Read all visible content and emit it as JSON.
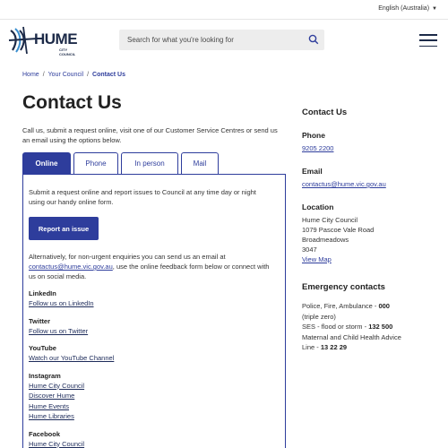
{
  "header": {
    "language": "English (Australia)",
    "logo_text": "HUME",
    "logo_sub": "CITY COUNCIL",
    "search_placeholder": "Search for what you're looking for"
  },
  "breadcrumb": [
    "Home",
    "Your Council",
    "Contact Us"
  ],
  "page_title": "Contact Us",
  "intro": "Call us, submit a request online, visit one of our Customer Service Centres or send us an email using the options below.",
  "tabs": [
    {
      "label": "Online",
      "active": true
    },
    {
      "label": "Phone",
      "active": false
    },
    {
      "label": "In person",
      "active": false
    },
    {
      "label": "Mail",
      "active": false
    }
  ],
  "online": {
    "text": "Submit a request online and report issues to Council at any time day or night using our handy online form.",
    "button": "Report an issue",
    "alt_before": "Alternatively, for non-urgent enquiries you can send us an email at ",
    "alt_email": "contactus@hume.vic.gov.au",
    "alt_after": ", use the online feedback form below or connect with us on social media.",
    "social": [
      {
        "title": "LinkedIn",
        "links": [
          "Follow us on LinkedIn"
        ]
      },
      {
        "title": "Twitter",
        "links": [
          "Follow us on Twitter"
        ]
      },
      {
        "title": "YouTube",
        "links": [
          "Watch our YouTube Channel"
        ]
      },
      {
        "title": "Instagram",
        "links": [
          "Hume City Council",
          "Discover Hume",
          "Hume Events",
          "Hume Libraries"
        ]
      },
      {
        "title": "Facebook",
        "links": [
          "Hume City Council"
        ]
      }
    ]
  },
  "sidebar": {
    "title": "Contact Us",
    "phone_label": "Phone",
    "phone": "9205 2200",
    "email_label": "Email",
    "email": "contactus@hume.vic.gov.au",
    "location_label": "Location",
    "address": [
      "Hume City Council",
      "1079 Pascoe Vale Road",
      "Broadmeadows",
      "3047"
    ],
    "map_link": "View Map"
  },
  "emergency": {
    "title": "Emergency contacts",
    "l1_text": "Police, Fire, Ambulance - ",
    "l1_num": "000",
    "l2_text": "(triple zero)",
    "l3_text": "SES - flood or storm - ",
    "l3_num": "132 500",
    "l4_text": "Maternal and Child Health Advice",
    "l5_text": "Line - ",
    "l5_num": "13 22 29"
  },
  "colors": {
    "brand": "#2e3d9c",
    "logo": "#1c2a48"
  }
}
